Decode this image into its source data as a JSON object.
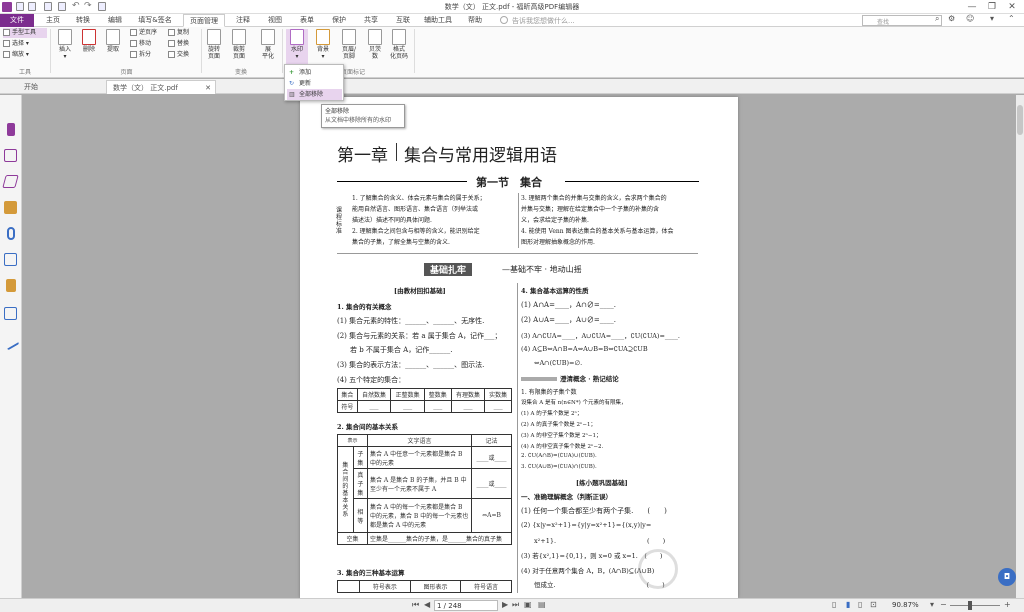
{
  "window": {
    "title": "数学（文） 正文.pdf - 福昕高级PDF编辑器",
    "minimize": "—",
    "restore": "❐",
    "close": "✕"
  },
  "ribbon_tabs": [
    {
      "label": "文件"
    },
    {
      "label": "主页"
    },
    {
      "label": "转换"
    },
    {
      "label": "编辑"
    },
    {
      "label": "填写&签名"
    },
    {
      "label": "页面管理"
    },
    {
      "label": "注释"
    },
    {
      "label": "视图"
    },
    {
      "label": "表单"
    },
    {
      "label": "保护"
    },
    {
      "label": "共享"
    },
    {
      "label": "互联"
    },
    {
      "label": "辅助工具"
    },
    {
      "label": "帮助"
    }
  ],
  "tell_me": "告诉我您想做什么...",
  "search_placeholder": "查找",
  "ribbon": {
    "tools": {
      "hand": "手型工具",
      "select": "选择",
      "zoom": "缩放",
      "group": "工具"
    },
    "pages": {
      "insert": "插入",
      "delete": "删除",
      "extract": "提取",
      "reverse": "逆页序",
      "move": "移动",
      "split": "拆分",
      "copy": "复制",
      "replace": "替换",
      "swap": "交换",
      "group": "页面"
    },
    "transform": {
      "rotate": "旋转\n页面",
      "crop": "裁剪\n页面",
      "flatten": "展\n平化",
      "group": "变换"
    },
    "watermark": {
      "watermark": "水印",
      "background": "背景",
      "header_footer": "页眉/\n页脚",
      "bates": "贝茨\n数",
      "format_page_numbers": "格式\n化页码",
      "group": "页面标记"
    }
  },
  "watermark_menu": {
    "add": "添加",
    "update": "更新",
    "remove_all": "全部移除"
  },
  "tooltip": {
    "title": "全部移除",
    "desc": "从文档中移除所有的水印"
  },
  "doc_tabs": {
    "start": "开始",
    "current": "数学（文） 正文.pdf",
    "close": "✕"
  },
  "status": {
    "page": "1 / 248",
    "zoom": "90.87%"
  },
  "doc": {
    "chapter": "第一章",
    "chapter_title": "集合与常用逻辑用语",
    "section": "第一节　集合",
    "goals_label": "课程标准",
    "goals_left": [
      "1. 了解集合的含义、体会元素与集合的属于关系；",
      "能用自然语言、图形语言、集合语言（列举法或",
      "描述法）描述不同的具体问题.",
      "2. 理解集合之间包含与相等的含义，能识别给定",
      "集合的子集，了解全集与空集的含义."
    ],
    "goals_right": [
      "3. 理解两个集合的并集与交集的含义，会求两个集合的",
      "并集与交集；理解在给定集合中一个子集的补集的含",
      "义，会求给定子集的补集.",
      "4. 能使用 Venn 图表达集合的基本关系与基本运算，体会",
      "图形对理解抽象概念的作用."
    ],
    "banner": "基础扎牢",
    "banner_sub": "—基础不牢 · 地动山摇",
    "left_head": "[由教材回扣基础]",
    "l1": "1. 集合的有关概念",
    "l1a": "(1) 集合元素的特性：______、______、无序性.",
    "l1b": "(2) 集合与元素的关系：若 a 属于集合 A，记作___；",
    "l1c": "若 b 不属于集合 A，记作______.",
    "l1d": "(3) 集合的表示方法：______、______、图示法.",
    "l1e": "(4) 五个特定的集合：",
    "t1_row1": [
      "集合",
      "自然数集",
      "正整数集",
      "整数集",
      "有理数集",
      "实数集"
    ],
    "t1_row2": [
      "符号",
      "",
      "",
      "",
      "",
      ""
    ],
    "l2": "2. 集合间的基本关系",
    "t2_head": [
      "表示",
      "文字语言",
      "记法"
    ],
    "t2_side": "集合间的基本关系",
    "t2_rows": [
      {
        "rel": "子集",
        "text": "集合 A 中任意一个元素都是集合 B 中的元素",
        "mark": "____或____"
      },
      {
        "rel": "真子集",
        "text": "集合 A 是集合 B 的子集，并且 B 中至少有一个元素不属于 A",
        "mark": "____或____"
      },
      {
        "rel": "相等",
        "text": "集合 A 中的每一个元素都是集合 B 中的元素，集合 B 中的每一个元素也都是集合 A 中的元素",
        "mark": "⇔A=B"
      },
      {
        "rel": "空集",
        "text": "空集是______集合的子集，是______集合的真子集",
        "mark": ""
      }
    ],
    "l3": "3. 集合的三种基本运算",
    "t3_head": [
      "",
      "符号表示",
      "图形表示",
      "符号语言"
    ],
    "r4": "4. 集合基本运算的性质",
    "r4a": "(1) A∩A=____，A∩∅=____.",
    "r4b": "(2) A∪A=____，A∪∅=____.",
    "r4c": "(3) A∩∁UA=____，A∪∁UA=____，∁U(∁UA)=____.",
    "r4d": "(4) A⊆B⇔A∩B=A⇔A∪B=B⇔∁UA⊇∁UB",
    "r4e": "⇔A∩(∁UB)=∅.",
    "clarify": "澄清概念 · 熟记结论",
    "c1": "1. 有限集的子集个数",
    "c2": "设集合 A 是有 n(n∈N*) 个元素的有限集，",
    "c3": "(1) A 的子集个数是 2ⁿ；",
    "c4": "(2) A 的真子集个数是 2ⁿ−1；",
    "c5": "(3) A 的非空子集个数是 2ⁿ−1；",
    "c6": "(4) A 的非空真子集个数是 2ⁿ−2.",
    "c7": "2. ∁U(A∩B)=(∁UA)∪(∁UB).",
    "c8": "3. ∁U(A∪B)=(∁UA)∩(∁UB).",
    "practice": "[练小题巩固基础]",
    "p0": "一、准确理解概念（判断正误）",
    "p1": "(1) 任何一个集合都至少有两个子集.　　(　　)",
    "p2": "(2) {x|y=x²+1}={y|y=x²+1}={(x,y)|y=",
    "p3": "x²+1}.　　　　　　　　　　　　　　(　　)",
    "p4": "(3) 若{x²,1}={0,1}，则 x=0 或 x=1.　(　　)",
    "p5": "(4) 对于任意两个集合 A，B，(A∩B)⊆(A∪B)",
    "p6": "恒成立.　　　　　　　　　　　　　　(　　)"
  }
}
